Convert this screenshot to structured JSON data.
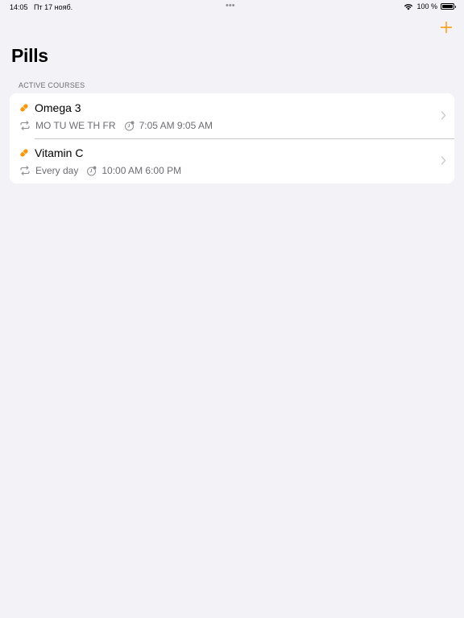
{
  "status_bar": {
    "time": "14:05",
    "date": "Пт 17 нояб.",
    "multitask": "•••",
    "battery_percent": "100 %",
    "battery_level": 1.0
  },
  "nav": {
    "add_icon": "plus-icon",
    "title": "Pills"
  },
  "section": {
    "header": "ACTIVE COURSES"
  },
  "courses": [
    {
      "name": "Omega 3",
      "schedule": "MO TU WE TH FR",
      "times": "7:05 AM 9:05 AM"
    },
    {
      "name": "Vitamin C",
      "schedule": "Every day",
      "times": "10:00 AM 6:00 PM"
    }
  ],
  "colors": {
    "accent": "#ff9500",
    "background": "#f2f2f7",
    "secondary_text": "#6d6d72"
  }
}
